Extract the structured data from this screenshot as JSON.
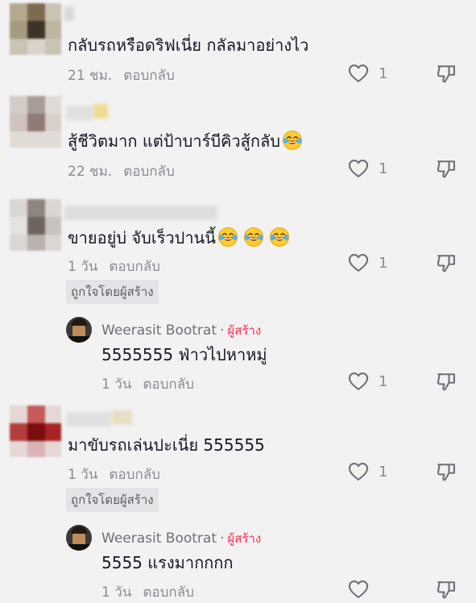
{
  "comments": [
    {
      "text": "กลับรถหรือดริฟเนี่ย กลัลมาอย่างไว",
      "time": "21 ชม.",
      "reply_label": "ตอบกลับ",
      "likes": "1"
    },
    {
      "text": "สู้ชีวิตมาก แต่ป้าบาร์บีคิวสู้กลับ",
      "time": "22 ชม.",
      "reply_label": "ตอบกลับ",
      "likes": "1",
      "emoji_count": 1
    },
    {
      "text": "ขายอยู่บ่ จับเร็วปานนี้",
      "time": "1 วัน",
      "reply_label": "ตอบกลับ",
      "likes": "1",
      "emoji_count": 3,
      "badge": "ถูกใจโดยผู้สร้าง",
      "reply": {
        "author": "Weerasit Bootrat",
        "tag": "ผู้สร้าง",
        "text": "5555555 ฟ่าวไปหาหมู่",
        "time": "1 วัน",
        "reply_label": "ตอบกลับ",
        "likes": "1"
      }
    },
    {
      "text": "มาขับรถเล่นปะเนี่ย 555555",
      "time": "1 วัน",
      "reply_label": "ตอบกลับ",
      "likes": "1",
      "badge": "ถูกใจโดยผู้สร้าง",
      "reply": {
        "author": "Weerasit Bootrat",
        "tag": "ผู้สร้าง",
        "text": "5555 แรงมากกกก",
        "time": "1 วัน",
        "reply_label": "ตอบกลับ",
        "likes": ""
      }
    }
  ],
  "icons": {
    "like": "heart-outline-icon",
    "dislike": "thumbs-down-outline-icon",
    "emoji": "laughing-tears-emoji"
  }
}
